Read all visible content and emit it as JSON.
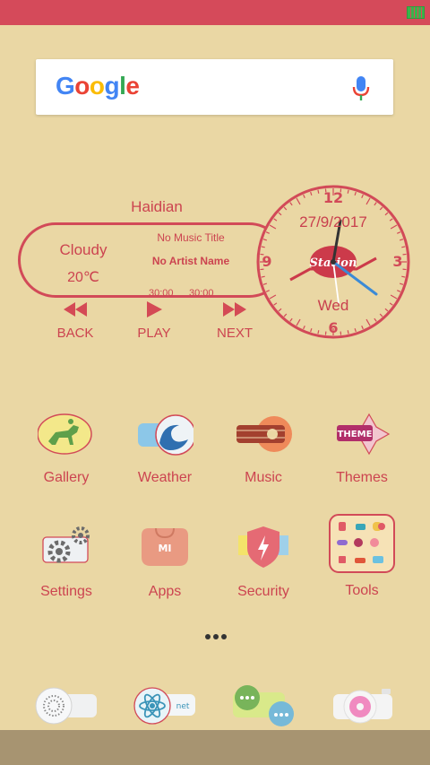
{
  "search": {
    "logo_letters": [
      "G",
      "o",
      "o",
      "g",
      "l",
      "e"
    ],
    "logo_colors": [
      "#4285f4",
      "#ea4335",
      "#fbbc05",
      "#4285f4",
      "#34a853",
      "#ea4335"
    ]
  },
  "music_widget": {
    "location": "Haidian",
    "weather_condition": "Cloudy",
    "temperature": "20℃",
    "title": "No Music Title",
    "artist": "No Artist Name",
    "elapsed": "30:00",
    "duration": "30:00",
    "controls": [
      {
        "label": "BACK",
        "icon": "rewind-icon"
      },
      {
        "label": "PLAY",
        "icon": "play-icon"
      },
      {
        "label": "NEXT",
        "icon": "fast-forward-icon"
      }
    ]
  },
  "clock": {
    "date": "27/9/2017",
    "day": "Wed",
    "logo_text": "Station",
    "numerals": [
      "12",
      "3",
      "6",
      "9"
    ]
  },
  "apps": [
    {
      "label": "Gallery",
      "icon": "horse-racing-icon"
    },
    {
      "label": "Weather",
      "icon": "wave-icon"
    },
    {
      "label": "Music",
      "icon": "guitar-icon"
    },
    {
      "label": "Themes",
      "icon": "theme-badge-icon",
      "badge_text": "THEME"
    },
    {
      "label": "Settings",
      "icon": "gears-icon"
    },
    {
      "label": "Apps",
      "icon": "mi-bag-icon",
      "badge_text": "MI"
    },
    {
      "label": "Security",
      "icon": "shield-bolt-icon"
    },
    {
      "label": "Tools",
      "icon": "tools-folder-icon"
    }
  ],
  "dock": [
    {
      "icon": "speaker-phone-icon"
    },
    {
      "icon": "atom-browser-icon",
      "badge_text": "net"
    },
    {
      "icon": "chat-bubbles-icon"
    },
    {
      "icon": "camera-icon"
    }
  ],
  "colors": {
    "accent": "#d44a55",
    "background": "#ead7a4",
    "status_bar": "#d54a5a",
    "nav_bar": "#a79471"
  }
}
